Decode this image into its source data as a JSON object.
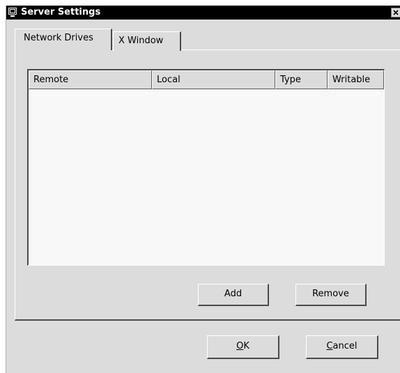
{
  "window": {
    "title": "Server Settings",
    "window_icon": "monitor-icon",
    "close_icon": "close-icon"
  },
  "tabs": [
    {
      "label": "Network Drives",
      "active": true
    },
    {
      "label": "X Window",
      "active": false
    }
  ],
  "table": {
    "columns": [
      "Remote",
      "Local",
      "Type",
      "Writable"
    ],
    "rows": []
  },
  "panel_buttons": {
    "add_label": "Add",
    "remove_label": "Remove"
  },
  "dialog_buttons": {
    "ok_mnemonic": "O",
    "ok_rest": "K",
    "cancel_mnemonic": "C",
    "cancel_rest": "ancel"
  },
  "colors": {
    "title_bar": "#000000",
    "dialog_bg": "#dcdcdc",
    "list_bg": "#f8f8f8"
  }
}
